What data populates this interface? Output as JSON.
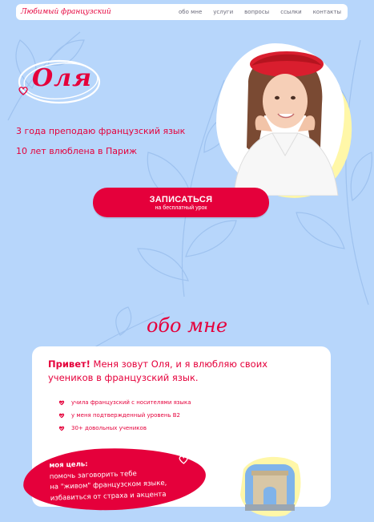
{
  "header": {
    "logo": "Любимый французский",
    "nav": [
      "обо мне",
      "услуги",
      "вопросы",
      "ссылки",
      "контакты"
    ]
  },
  "hero": {
    "name": "Оля",
    "line1": "3 года преподаю французский язык",
    "line2": "10 лет влюблена в Париж"
  },
  "cta": {
    "main": "ЗАПИСАТЬСЯ",
    "sub": "на бесплатный урок"
  },
  "about": {
    "title": "обо мне",
    "intro_bold": "Привет!",
    "intro_rest": " Меня зовут Оля, и я влюбляю своих учеников в французский язык.",
    "bullets": [
      "учила французский с носителями языка",
      "у меня подтвержденный уровень B2",
      "30+ довольных учеников"
    ],
    "goal": {
      "title": "моя цель:",
      "lines": [
        "помочь заговорить тебе",
        "на \"живом\" французском языке,",
        "избавиться от страха и акцента"
      ]
    }
  },
  "colors": {
    "background": "#b7d6fb",
    "accent": "#e5003b",
    "highlight": "#fff7a8"
  }
}
